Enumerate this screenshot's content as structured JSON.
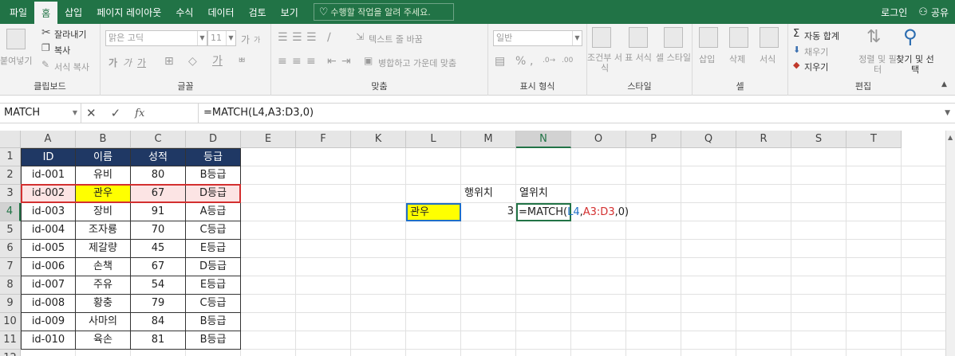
{
  "tabs": [
    "파일",
    "홈",
    "삽입",
    "페이지 레이아웃",
    "수식",
    "데이터",
    "검토",
    "보기"
  ],
  "active_tab": "홈",
  "tell_me": "수행할 작업을 알려 주세요.",
  "login": "로그인",
  "share": "공유",
  "ribbon": {
    "clipboard": {
      "paste": "붙여넣기",
      "cut": "잘라내기",
      "copy": "복사",
      "format_painter": "서식 복사",
      "label": "클립보드"
    },
    "font": {
      "name": "맑은 고딕",
      "size": "11",
      "grow": "가",
      "shrink": "가",
      "bold": "가",
      "italic": "가",
      "underline": "가",
      "label": "글꼴"
    },
    "align": {
      "wrap": "텍스트 줄 바꿈",
      "merge": "병합하고 가운데 맞춤",
      "label": "맞춤"
    },
    "number": {
      "format": "일반",
      "label": "표시 형식"
    },
    "styles": {
      "conditional": "조건부 서식",
      "table": "표 서식",
      "cell": "셀 스타일",
      "label": "스타일"
    },
    "cells": {
      "insert": "삽입",
      "delete": "삭제",
      "format": "서식",
      "label": "셀"
    },
    "editing": {
      "autosum": "자동 합계",
      "fill": "채우기",
      "clear": "지우기",
      "sort": "정렬 및 필터",
      "find": "찾기 및 선택",
      "label": "편집"
    }
  },
  "name_box": "MATCH",
  "formula": "=MATCH(L4,A3:D3,0)",
  "columns": [
    "A",
    "B",
    "C",
    "D",
    "E",
    "F",
    "K",
    "L",
    "M",
    "N",
    "O",
    "P",
    "Q",
    "R",
    "S",
    "T"
  ],
  "rows": [
    "1",
    "2",
    "3",
    "4",
    "5",
    "6",
    "7",
    "8",
    "9",
    "10",
    "11",
    "12"
  ],
  "table": {
    "headers": [
      "ID",
      "이름",
      "성적",
      "등급"
    ],
    "rows": [
      [
        "id-001",
        "유비",
        "80",
        "B등급"
      ],
      [
        "id-002",
        "관우",
        "67",
        "D등급"
      ],
      [
        "id-003",
        "장비",
        "91",
        "A등급"
      ],
      [
        "id-004",
        "조자룡",
        "70",
        "C등급"
      ],
      [
        "id-005",
        "제갈량",
        "45",
        "E등급"
      ],
      [
        "id-006",
        "손책",
        "67",
        "D등급"
      ],
      [
        "id-007",
        "주유",
        "54",
        "E등급"
      ],
      [
        "id-008",
        "황충",
        "79",
        "C등급"
      ],
      [
        "id-009",
        "사마의",
        "84",
        "B등급"
      ],
      [
        "id-010",
        "육손",
        "81",
        "B등급"
      ]
    ]
  },
  "side": {
    "m3": "행위치",
    "n3": "열위치",
    "l4": "관우",
    "m4": "3",
    "n4_parts": [
      "=MATCH(",
      "L4",
      ",",
      "A3:D3",
      ",0)"
    ]
  },
  "colors": {
    "excel_green": "#217346",
    "header_navy": "#1f3864",
    "highlight_yellow": "#ffff00",
    "row_pink": "#fce4e4",
    "ref_blue": "#1f6fc6",
    "ref_red": "#d32f2f"
  }
}
